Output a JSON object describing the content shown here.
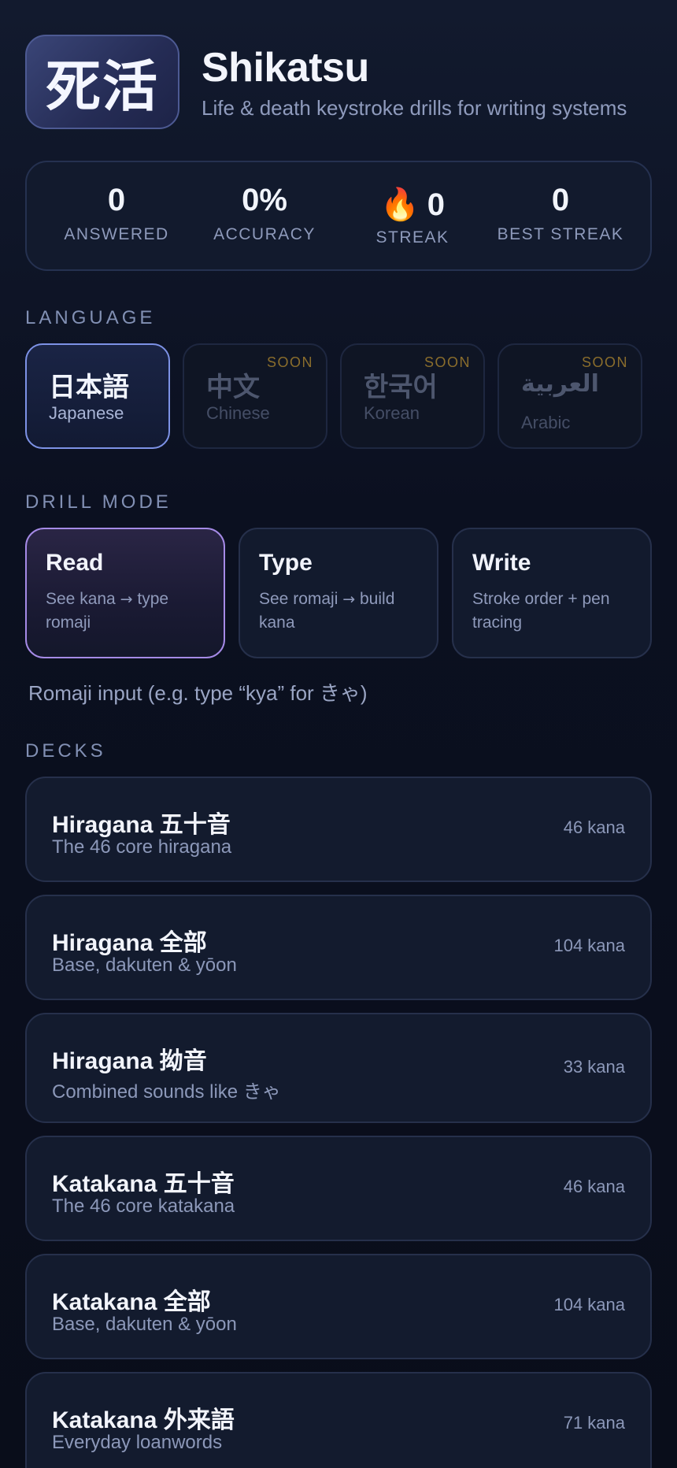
{
  "app": {
    "logo_text": "死活",
    "title": "Shikatsu",
    "subtitle": "Life & death keystroke drills for writing systems"
  },
  "stats": [
    {
      "value": "0",
      "label": "ANSWERED"
    },
    {
      "value": "0%",
      "label": "ACCURACY"
    },
    {
      "value": "0",
      "label": "STREAK",
      "icon": "fire-icon"
    },
    {
      "value": "0",
      "label": "BEST STREAK"
    }
  ],
  "language": {
    "heading": "LANGUAGE",
    "items": [
      {
        "native": "日本語",
        "name": "Japanese",
        "badge": "",
        "active": true
      },
      {
        "native": "中文",
        "name": "Chinese",
        "badge": "SOON",
        "active": false
      },
      {
        "native": "한국어",
        "name": "Korean",
        "badge": "SOON",
        "active": false
      },
      {
        "native": "العربية",
        "name": "Arabic",
        "badge": "SOON",
        "active": false
      }
    ]
  },
  "drill_mode": {
    "heading": "DRILL MODE",
    "items": [
      {
        "title": "Read",
        "desc_before": "See kana",
        "arrow": "→",
        "desc_after": "type romaji",
        "active": true
      },
      {
        "title": "Type",
        "desc_before": "See romaji",
        "arrow": "→",
        "desc_after": "build kana",
        "active": false
      },
      {
        "title": "Write",
        "desc_before": "Stroke order + pen tracing",
        "arrow": "",
        "desc_after": "",
        "active": false
      }
    ],
    "hint": "Romaji input (e.g. type “kya” for きゃ)"
  },
  "decks": {
    "heading": "DECKS",
    "items": [
      {
        "title_latin": "Hiragana",
        "title_cjk": "五十音",
        "subtitle": "The 46 core hiragana",
        "count": "46 kana"
      },
      {
        "title_latin": "Hiragana",
        "title_cjk": "全部",
        "subtitle": "Base, dakuten & yōon",
        "count": "104 kana"
      },
      {
        "title_latin": "Hiragana",
        "title_cjk": "拗音",
        "subtitle": "Combined sounds like きゃ",
        "count": "33 kana"
      },
      {
        "title_latin": "Katakana",
        "title_cjk": "五十音",
        "subtitle": "The 46 core katakana",
        "count": "46 kana"
      },
      {
        "title_latin": "Katakana",
        "title_cjk": "全部",
        "subtitle": "Base, dakuten & yōon",
        "count": "104 kana"
      },
      {
        "title_latin": "Katakana",
        "title_cjk": "外来語",
        "subtitle": "Everyday loanwords",
        "count": "71 kana"
      }
    ]
  },
  "colors": {
    "background": "#0b1020",
    "card": "#121a2d",
    "active_language_border": "#7d92e6",
    "active_mode_border": "#a58ae6",
    "soon_badge": "#8a6d2c",
    "flame": "#ff7a1a"
  }
}
